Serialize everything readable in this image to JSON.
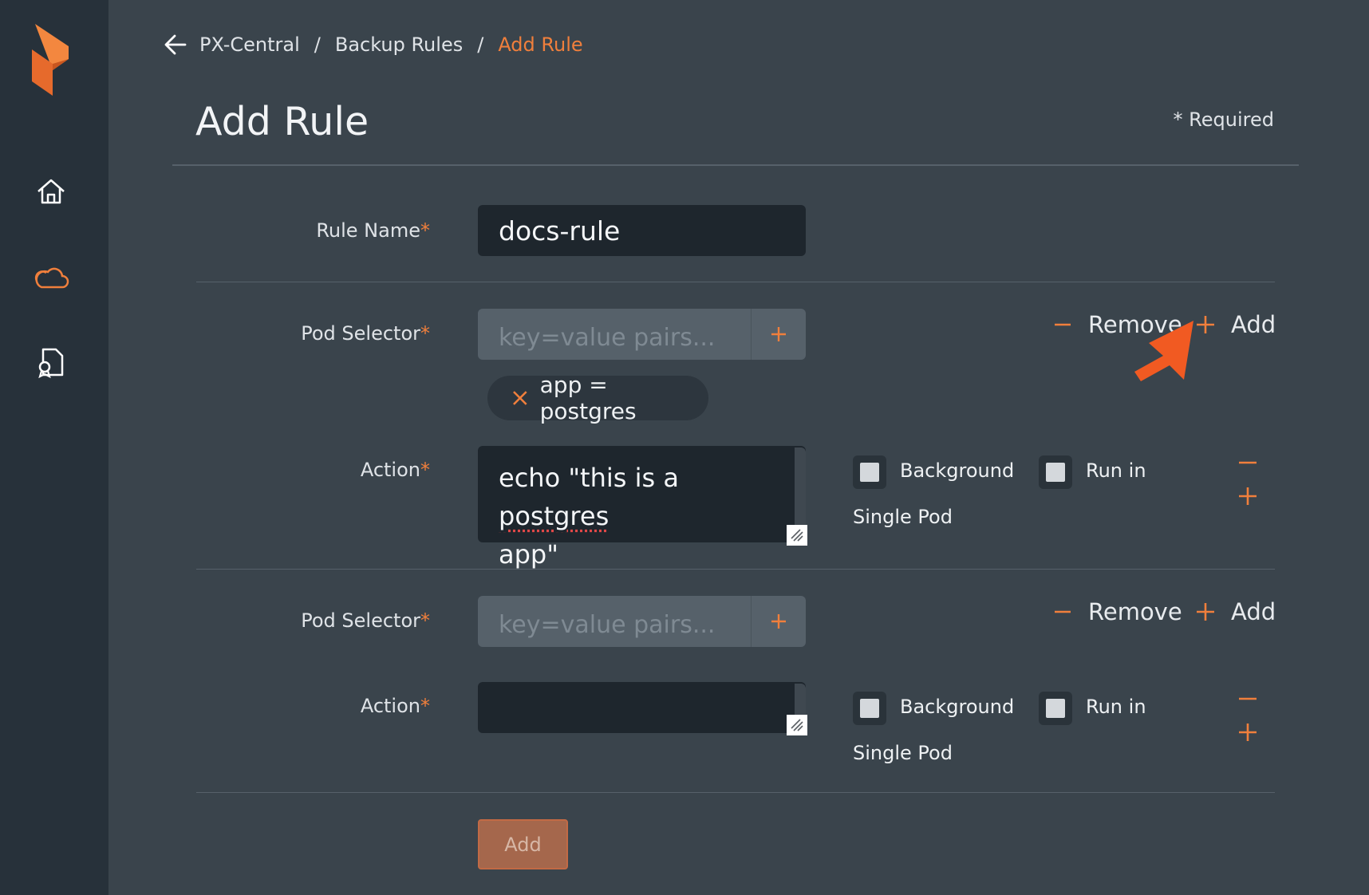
{
  "breadcrumb": {
    "items": [
      "PX-Central",
      "Backup Rules"
    ],
    "current": "Add Rule",
    "separator": "/"
  },
  "page": {
    "title": "Add Rule",
    "required_note": "* Required"
  },
  "form": {
    "rule_name_label": "Rule Name",
    "rule_name_value": "docs-rule",
    "required_mark": "*",
    "pod_selector_label": "Pod Selector",
    "pod_selector_placeholder": "key=value pairs...",
    "action_label": "Action",
    "remove_label": "Remove",
    "add_label": "Add",
    "background_label": "Background",
    "single_pod_label": "Single Pod",
    "run_in_label": "Run in",
    "submit_label": "Add"
  },
  "rules": [
    {
      "chip": "app = postgres",
      "action_text_a": "echo \"this is a ",
      "action_text_misspelled": "postgres",
      "action_text_b": "app\"",
      "background_checked": false,
      "run_in_single_pod_checked": false
    },
    {
      "chip": "",
      "action_text": "",
      "background_checked": false,
      "run_in_single_pod_checked": false
    }
  ],
  "sidebar": {
    "items": [
      "home-icon",
      "cloud-icon",
      "certificate-icon"
    ]
  },
  "colors": {
    "accent": "#f07f3c",
    "sidebar_bg": "#27313a",
    "page_bg": "#3a444c",
    "input_bg": "#1e262d",
    "selector_bg": "#56616a"
  }
}
